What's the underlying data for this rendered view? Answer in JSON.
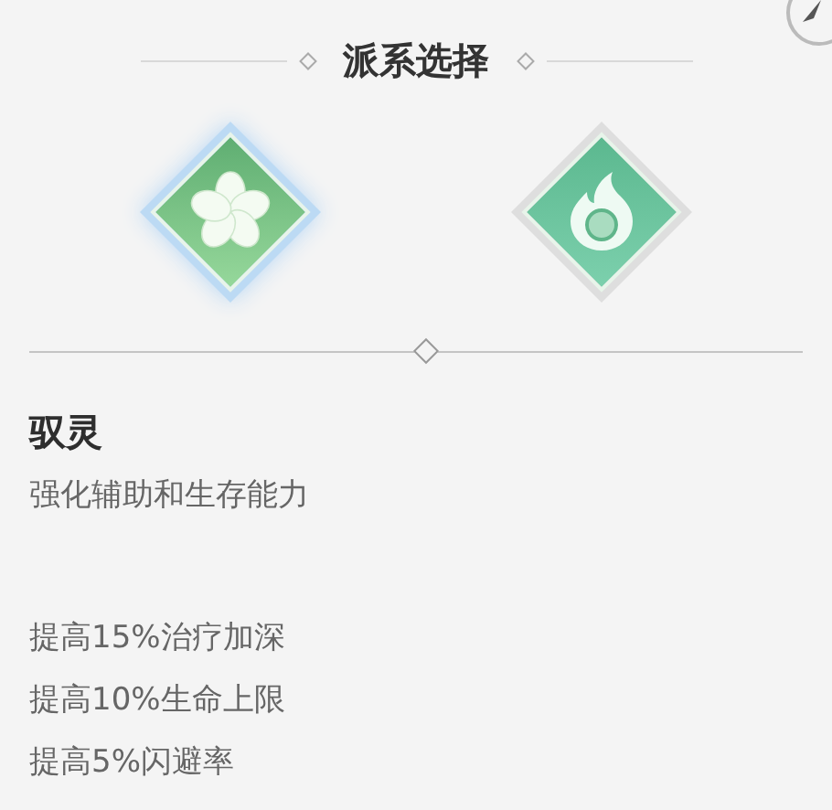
{
  "title": "派系选择",
  "factions": [
    {
      "kind": "flower",
      "selected": true
    },
    {
      "kind": "flame",
      "selected": false
    }
  ],
  "detail": {
    "name": "驭灵",
    "description": "强化辅助和生存能力",
    "bonuses": [
      "提高15%治疗加深",
      "提高10%生命上限",
      "提高5%闪避率"
    ]
  }
}
